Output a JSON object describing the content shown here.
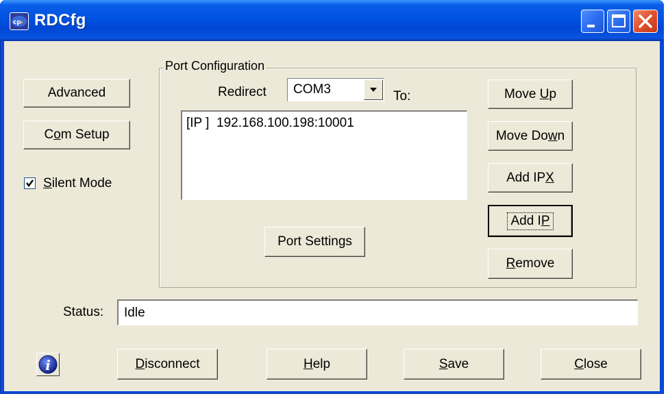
{
  "window": {
    "title": "RDCfg"
  },
  "left_panel": {
    "advanced_label": "Advanced",
    "com_setup": {
      "pre": "C",
      "u": "o",
      "post": "m Setup"
    },
    "silent_mode": {
      "checked": true,
      "pre": "",
      "u": "S",
      "post": "ilent Mode"
    }
  },
  "port_config": {
    "group_label": "Port Configuration",
    "redirect_label": "Redirect",
    "port_selected": "COM3",
    "to_label": "To:",
    "list_items": [
      "[IP ]  192.168.100.198:10001"
    ],
    "port_settings_label": "Port Settings"
  },
  "right_buttons": {
    "move_up": {
      "pre": "Move ",
      "u": "U",
      "post": "p"
    },
    "move_down": {
      "pre": "Move Do",
      "u": "w",
      "post": "n"
    },
    "add_ipx": {
      "pre": "Add IP",
      "u": "X",
      "post": ""
    },
    "add_ip": {
      "pre": "Add I",
      "u": "P",
      "post": ""
    },
    "remove": {
      "pre": "",
      "u": "R",
      "post": "emove"
    }
  },
  "status": {
    "label": "Status:",
    "value": "Idle"
  },
  "bottom_buttons": {
    "disconnect": {
      "pre": "",
      "u": "D",
      "post": "isconnect"
    },
    "help": {
      "pre": "",
      "u": "H",
      "post": "elp"
    },
    "save": {
      "pre": "",
      "u": "S",
      "post": "ave"
    },
    "close": {
      "pre": "",
      "u": "C",
      "post": "lose"
    }
  },
  "icons": {
    "app": "rdcfg-app-icon",
    "info": "info-icon",
    "minimize": "minimize-icon",
    "maximize": "maximize-icon",
    "close": "close-icon",
    "dropdown": "chevron-down-icon",
    "check": "check-icon"
  },
  "colors": {
    "titlebar": "#0052e0",
    "face": "#ece9d8",
    "close_button": "#e0502c"
  }
}
